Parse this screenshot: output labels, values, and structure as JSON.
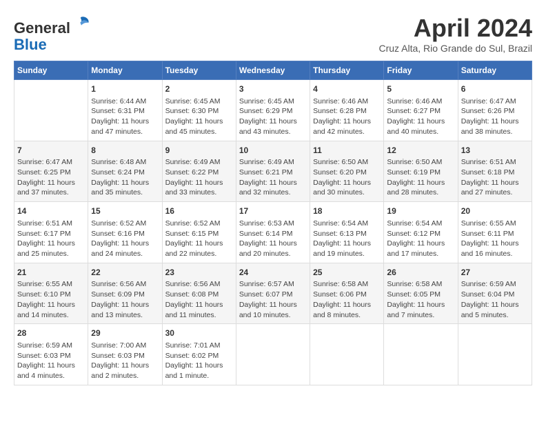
{
  "header": {
    "logo_general": "General",
    "logo_blue": "Blue",
    "month_title": "April 2024",
    "location": "Cruz Alta, Rio Grande do Sul, Brazil"
  },
  "weekdays": [
    "Sunday",
    "Monday",
    "Tuesday",
    "Wednesday",
    "Thursday",
    "Friday",
    "Saturday"
  ],
  "weeks": [
    [
      {
        "day": "",
        "info": ""
      },
      {
        "day": "1",
        "info": "Sunrise: 6:44 AM\nSunset: 6:31 PM\nDaylight: 11 hours\nand 47 minutes."
      },
      {
        "day": "2",
        "info": "Sunrise: 6:45 AM\nSunset: 6:30 PM\nDaylight: 11 hours\nand 45 minutes."
      },
      {
        "day": "3",
        "info": "Sunrise: 6:45 AM\nSunset: 6:29 PM\nDaylight: 11 hours\nand 43 minutes."
      },
      {
        "day": "4",
        "info": "Sunrise: 6:46 AM\nSunset: 6:28 PM\nDaylight: 11 hours\nand 42 minutes."
      },
      {
        "day": "5",
        "info": "Sunrise: 6:46 AM\nSunset: 6:27 PM\nDaylight: 11 hours\nand 40 minutes."
      },
      {
        "day": "6",
        "info": "Sunrise: 6:47 AM\nSunset: 6:26 PM\nDaylight: 11 hours\nand 38 minutes."
      }
    ],
    [
      {
        "day": "7",
        "info": "Sunrise: 6:47 AM\nSunset: 6:25 PM\nDaylight: 11 hours\nand 37 minutes."
      },
      {
        "day": "8",
        "info": "Sunrise: 6:48 AM\nSunset: 6:24 PM\nDaylight: 11 hours\nand 35 minutes."
      },
      {
        "day": "9",
        "info": "Sunrise: 6:49 AM\nSunset: 6:22 PM\nDaylight: 11 hours\nand 33 minutes."
      },
      {
        "day": "10",
        "info": "Sunrise: 6:49 AM\nSunset: 6:21 PM\nDaylight: 11 hours\nand 32 minutes."
      },
      {
        "day": "11",
        "info": "Sunrise: 6:50 AM\nSunset: 6:20 PM\nDaylight: 11 hours\nand 30 minutes."
      },
      {
        "day": "12",
        "info": "Sunrise: 6:50 AM\nSunset: 6:19 PM\nDaylight: 11 hours\nand 28 minutes."
      },
      {
        "day": "13",
        "info": "Sunrise: 6:51 AM\nSunset: 6:18 PM\nDaylight: 11 hours\nand 27 minutes."
      }
    ],
    [
      {
        "day": "14",
        "info": "Sunrise: 6:51 AM\nSunset: 6:17 PM\nDaylight: 11 hours\nand 25 minutes."
      },
      {
        "day": "15",
        "info": "Sunrise: 6:52 AM\nSunset: 6:16 PM\nDaylight: 11 hours\nand 24 minutes."
      },
      {
        "day": "16",
        "info": "Sunrise: 6:52 AM\nSunset: 6:15 PM\nDaylight: 11 hours\nand 22 minutes."
      },
      {
        "day": "17",
        "info": "Sunrise: 6:53 AM\nSunset: 6:14 PM\nDaylight: 11 hours\nand 20 minutes."
      },
      {
        "day": "18",
        "info": "Sunrise: 6:54 AM\nSunset: 6:13 PM\nDaylight: 11 hours\nand 19 minutes."
      },
      {
        "day": "19",
        "info": "Sunrise: 6:54 AM\nSunset: 6:12 PM\nDaylight: 11 hours\nand 17 minutes."
      },
      {
        "day": "20",
        "info": "Sunrise: 6:55 AM\nSunset: 6:11 PM\nDaylight: 11 hours\nand 16 minutes."
      }
    ],
    [
      {
        "day": "21",
        "info": "Sunrise: 6:55 AM\nSunset: 6:10 PM\nDaylight: 11 hours\nand 14 minutes."
      },
      {
        "day": "22",
        "info": "Sunrise: 6:56 AM\nSunset: 6:09 PM\nDaylight: 11 hours\nand 13 minutes."
      },
      {
        "day": "23",
        "info": "Sunrise: 6:56 AM\nSunset: 6:08 PM\nDaylight: 11 hours\nand 11 minutes."
      },
      {
        "day": "24",
        "info": "Sunrise: 6:57 AM\nSunset: 6:07 PM\nDaylight: 11 hours\nand 10 minutes."
      },
      {
        "day": "25",
        "info": "Sunrise: 6:58 AM\nSunset: 6:06 PM\nDaylight: 11 hours\nand 8 minutes."
      },
      {
        "day": "26",
        "info": "Sunrise: 6:58 AM\nSunset: 6:05 PM\nDaylight: 11 hours\nand 7 minutes."
      },
      {
        "day": "27",
        "info": "Sunrise: 6:59 AM\nSunset: 6:04 PM\nDaylight: 11 hours\nand 5 minutes."
      }
    ],
    [
      {
        "day": "28",
        "info": "Sunrise: 6:59 AM\nSunset: 6:03 PM\nDaylight: 11 hours\nand 4 minutes."
      },
      {
        "day": "29",
        "info": "Sunrise: 7:00 AM\nSunset: 6:03 PM\nDaylight: 11 hours\nand 2 minutes."
      },
      {
        "day": "30",
        "info": "Sunrise: 7:01 AM\nSunset: 6:02 PM\nDaylight: 11 hours\nand 1 minute."
      },
      {
        "day": "",
        "info": ""
      },
      {
        "day": "",
        "info": ""
      },
      {
        "day": "",
        "info": ""
      },
      {
        "day": "",
        "info": ""
      }
    ]
  ]
}
